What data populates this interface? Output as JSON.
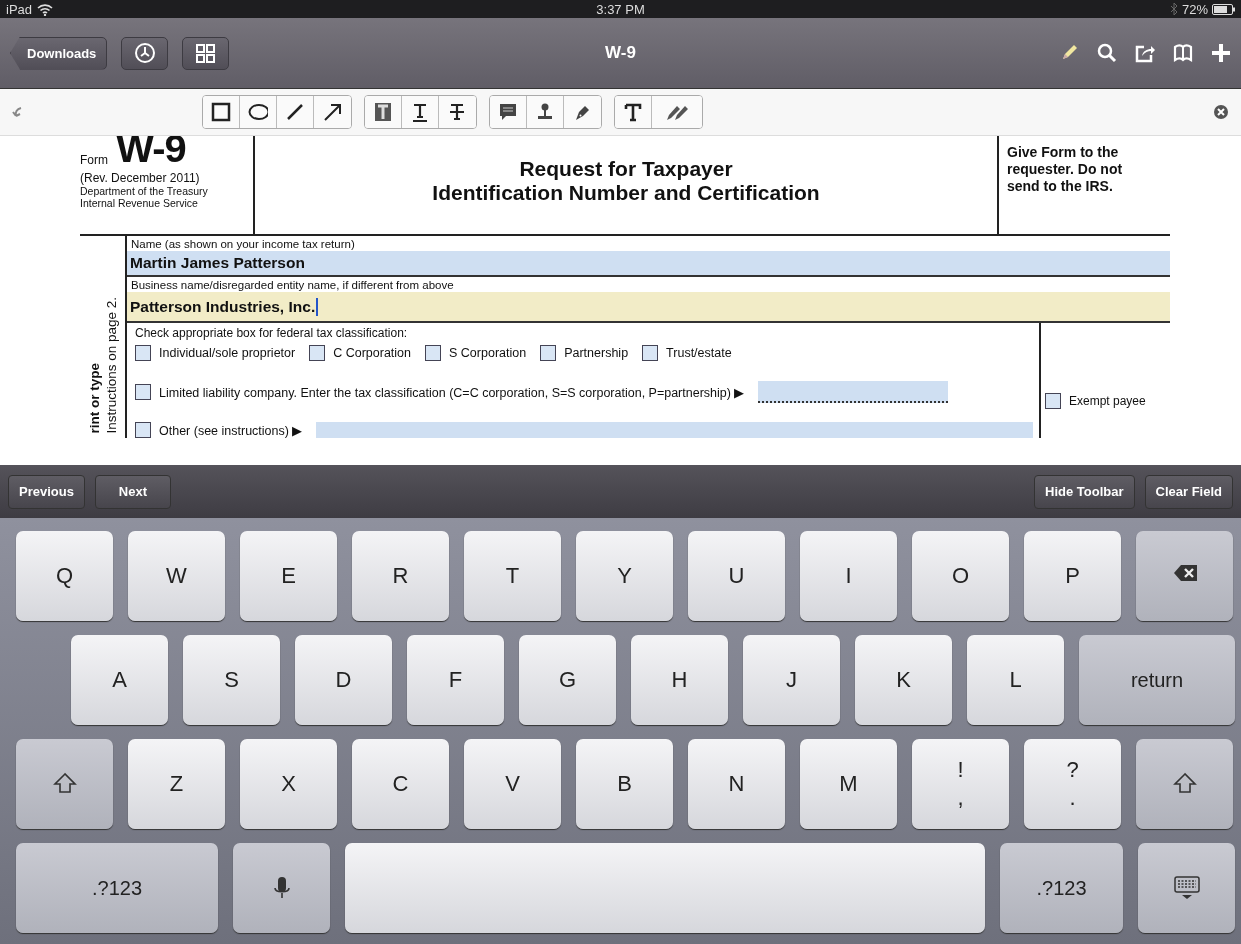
{
  "status_bar": {
    "device": "iPad",
    "time": "3:37 PM",
    "battery": "72%"
  },
  "nav_bar": {
    "back": "Downloads",
    "title": "W-9"
  },
  "annotation_toolbar": {
    "groups": [
      {
        "tools": [
          {
            "kind": "rectangle"
          },
          {
            "kind": "ellipse"
          },
          {
            "kind": "line"
          },
          {
            "kind": "arrow"
          }
        ]
      },
      {
        "tools": [
          {
            "kind": "highlight"
          },
          {
            "kind": "underline"
          },
          {
            "kind": "strikeout"
          }
        ]
      },
      {
        "tools": [
          {
            "kind": "note"
          },
          {
            "kind": "stamp"
          },
          {
            "kind": "pen"
          }
        ]
      },
      {
        "tools": [
          {
            "kind": "text"
          },
          {
            "kind": "pencils"
          }
        ]
      }
    ]
  },
  "form": {
    "form_word": "Form",
    "number": "W-9",
    "revision": "(Rev. December 2011)",
    "agency": [
      "Department of the Treasury",
      "Internal Revenue Service"
    ],
    "title": [
      "Request for Taxpayer",
      "Identification Number and Certification"
    ],
    "notice": "Give Form to the requester. Do not send to the IRS.",
    "side_text": [
      "rint or type",
      "Instructions on page 2."
    ],
    "name_label": "Name (as shown on your income tax return)",
    "name_value": "Martin James Patterson",
    "business_label": "Business name/disregarded entity name, if different from above",
    "business_value": "Patterson Industries, Inc.",
    "classification_label": "Check appropriate box for federal tax classification:",
    "classifications": [
      {
        "label": "Individual/sole proprietor",
        "checked": false
      },
      {
        "label": "C Corporation",
        "checked": false
      },
      {
        "label": "S Corporation",
        "checked": false
      },
      {
        "label": "Partnership",
        "checked": false
      },
      {
        "label": "Trust/estate",
        "checked": false
      }
    ],
    "llc": {
      "label": "Limited liability company. Enter the tax classification (C=C corporation, S=S corporation, P=partnership) ▶",
      "checked": false
    },
    "exempt": {
      "label": "Exempt payee",
      "checked": false
    },
    "other": {
      "label": "Other (see instructions) ▶",
      "checked": false
    }
  },
  "accessory_bar": {
    "left": [
      "Previous",
      "Next"
    ],
    "right": [
      "Hide Toolbar",
      "Clear Field"
    ]
  },
  "keyboard": {
    "rows": [
      {
        "keys": [
          {
            "kind": "char",
            "label": "Q"
          },
          {
            "kind": "char",
            "label": "W"
          },
          {
            "kind": "char",
            "label": "E"
          },
          {
            "kind": "char",
            "label": "R"
          },
          {
            "kind": "char",
            "label": "T"
          },
          {
            "kind": "char",
            "label": "Y"
          },
          {
            "kind": "char",
            "label": "U"
          },
          {
            "kind": "char",
            "label": "I"
          },
          {
            "kind": "char",
            "label": "O"
          },
          {
            "kind": "char",
            "label": "P"
          },
          {
            "kind": "backspace"
          }
        ]
      },
      {
        "keys": [
          {
            "kind": "char",
            "label": "A"
          },
          {
            "kind": "char",
            "label": "S"
          },
          {
            "kind": "char",
            "label": "D"
          },
          {
            "kind": "char",
            "label": "F"
          },
          {
            "kind": "char",
            "label": "G"
          },
          {
            "kind": "char",
            "label": "H"
          },
          {
            "kind": "char",
            "label": "J"
          },
          {
            "kind": "char",
            "label": "K"
          },
          {
            "kind": "char",
            "label": "L"
          },
          {
            "kind": "return",
            "label": "return"
          }
        ]
      },
      {
        "keys": [
          {
            "kind": "shift"
          },
          {
            "kind": "char",
            "label": "Z"
          },
          {
            "kind": "char",
            "label": "X"
          },
          {
            "kind": "char",
            "label": "C"
          },
          {
            "kind": "char",
            "label": "V"
          },
          {
            "kind": "char",
            "label": "B"
          },
          {
            "kind": "char",
            "label": "N"
          },
          {
            "kind": "char",
            "label": "M"
          },
          {
            "kind": "punct",
            "top": "!",
            "bottom": ","
          },
          {
            "kind": "punct",
            "top": "?",
            "bottom": "."
          },
          {
            "kind": "shift"
          }
        ]
      },
      {
        "keys": [
          {
            "kind": "mode",
            "label": ".?123"
          },
          {
            "kind": "mic"
          },
          {
            "kind": "space"
          },
          {
            "kind": "mode",
            "label": ".?123"
          },
          {
            "kind": "dismiss"
          }
        ]
      }
    ]
  }
}
